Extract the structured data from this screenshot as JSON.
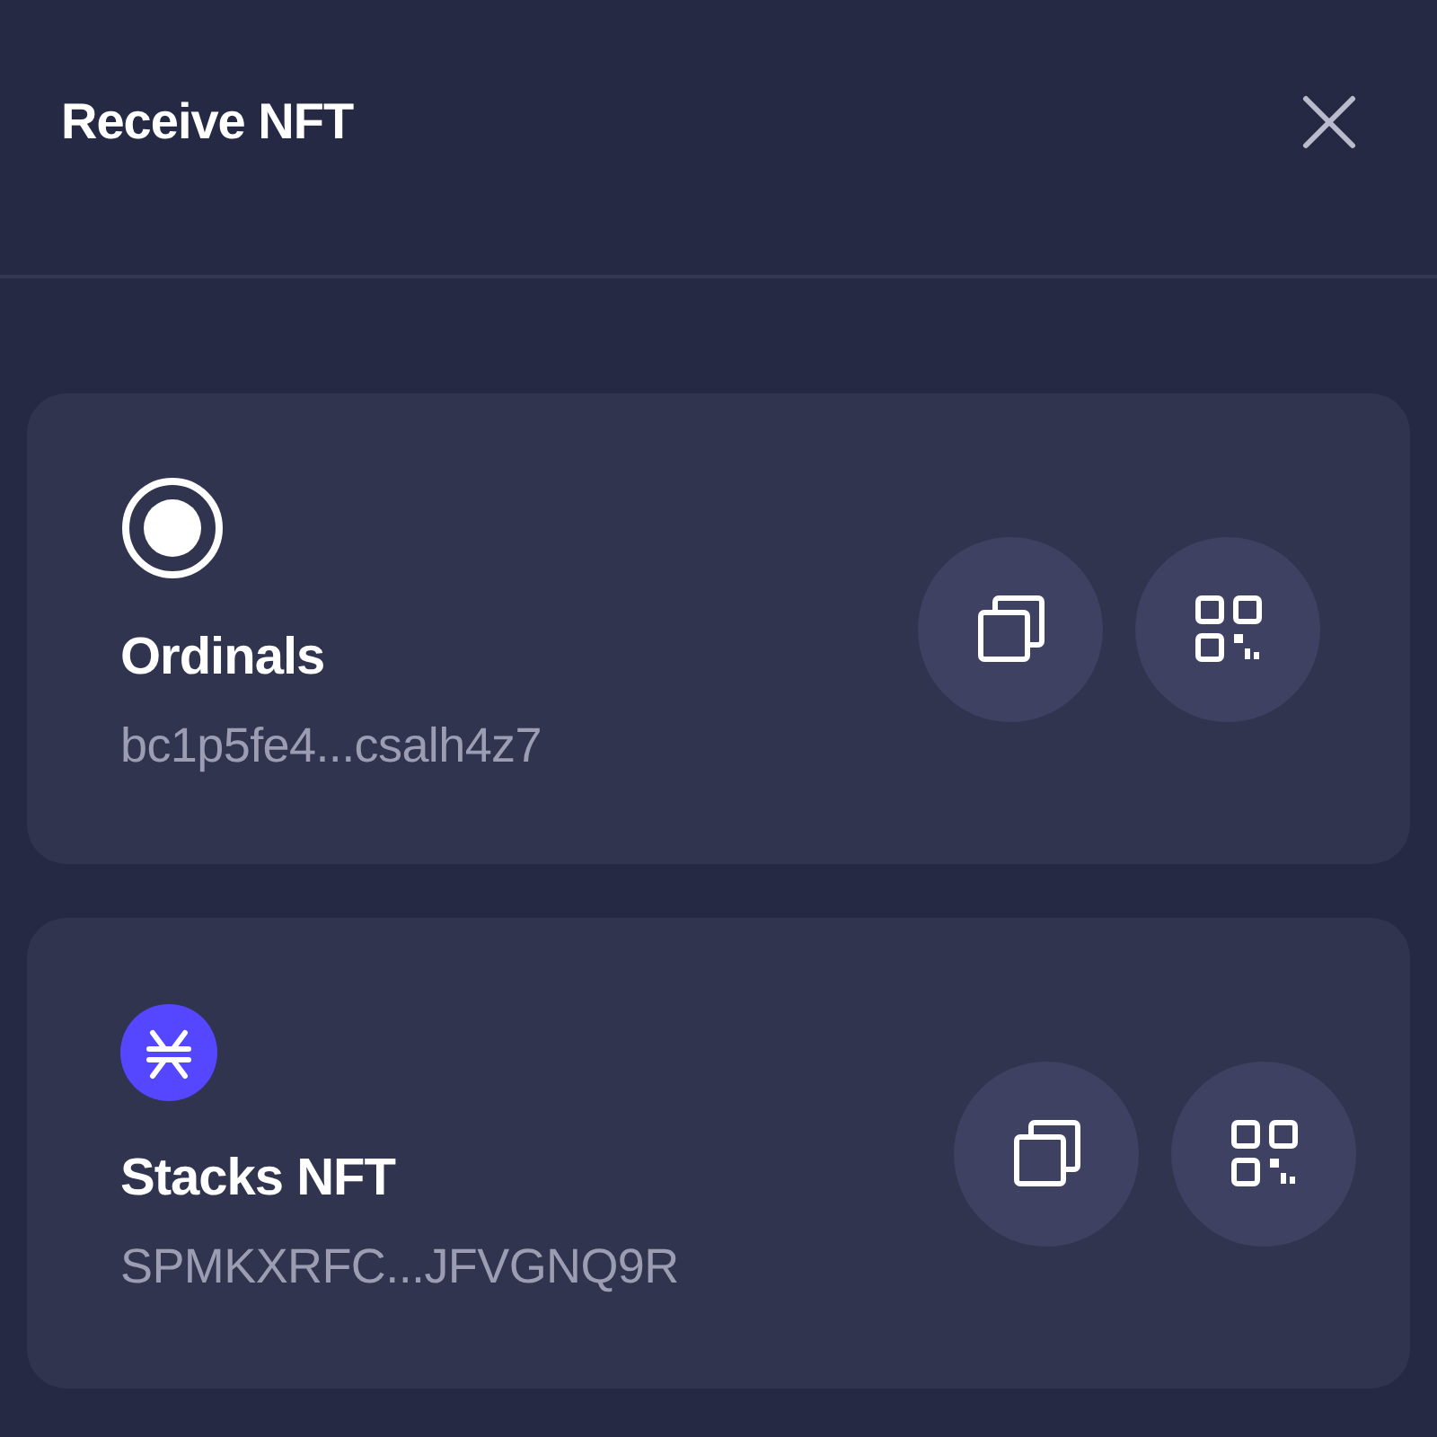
{
  "header": {
    "title": "Receive NFT"
  },
  "accounts": [
    {
      "kind": "ordinals",
      "name": "Ordinals",
      "address": "bc1p5fe4...csalh4z7"
    },
    {
      "kind": "stacks",
      "name": "Stacks NFT",
      "address": "SPMKXRFC...JFVGNQ9R"
    }
  ]
}
